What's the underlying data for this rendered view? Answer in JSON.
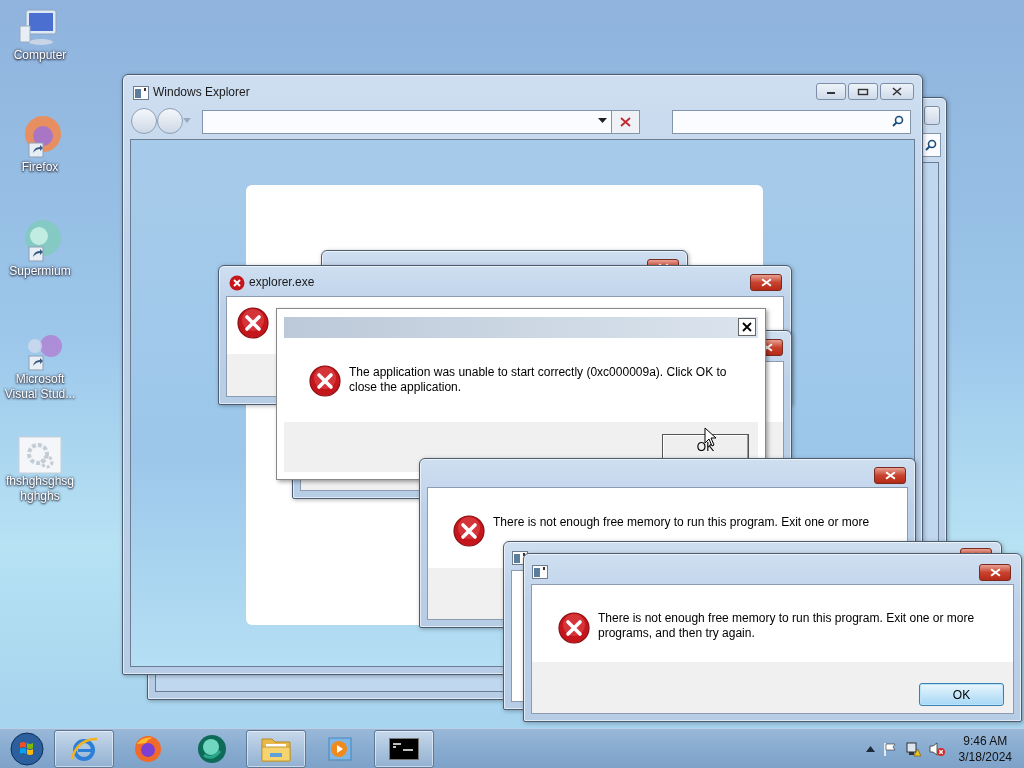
{
  "desktop_icons": [
    {
      "kind": "computer",
      "label": "Computer"
    },
    {
      "kind": "firefox",
      "label": "Firefox"
    },
    {
      "kind": "supermium",
      "label": "Supermium"
    },
    {
      "kind": "visualstudio",
      "label": "Microsoft Visual Stud..."
    },
    {
      "kind": "file",
      "label": "fhshghsghsghghghs"
    }
  ],
  "explorer": {
    "title": "Windows Explorer"
  },
  "dialogs": [
    {
      "kind": "titled",
      "title": "explorer.exe"
    },
    {
      "kind": "plain",
      "message": "The application was unable to start correctly (0xc000009a). Click OK to close the application.",
      "button": "OK"
    },
    {
      "kind": "covered",
      "message": "There is not enough free memory to run this program. Exit one or more"
    },
    {
      "kind": "front",
      "message": "There is not enough free memory to run this program. Exit one or more programs, and then try again.",
      "button": "OK"
    }
  ],
  "taskbar": {
    "items": [
      {
        "kind": "ie",
        "running": true
      },
      {
        "kind": "firefox",
        "running": false
      },
      {
        "kind": "supermium",
        "running": false
      },
      {
        "kind": "folder",
        "running": true
      },
      {
        "kind": "media",
        "running": false
      },
      {
        "kind": "cmd",
        "running": true
      }
    ],
    "time": "9:46 AM",
    "date": "3/18/2024"
  }
}
